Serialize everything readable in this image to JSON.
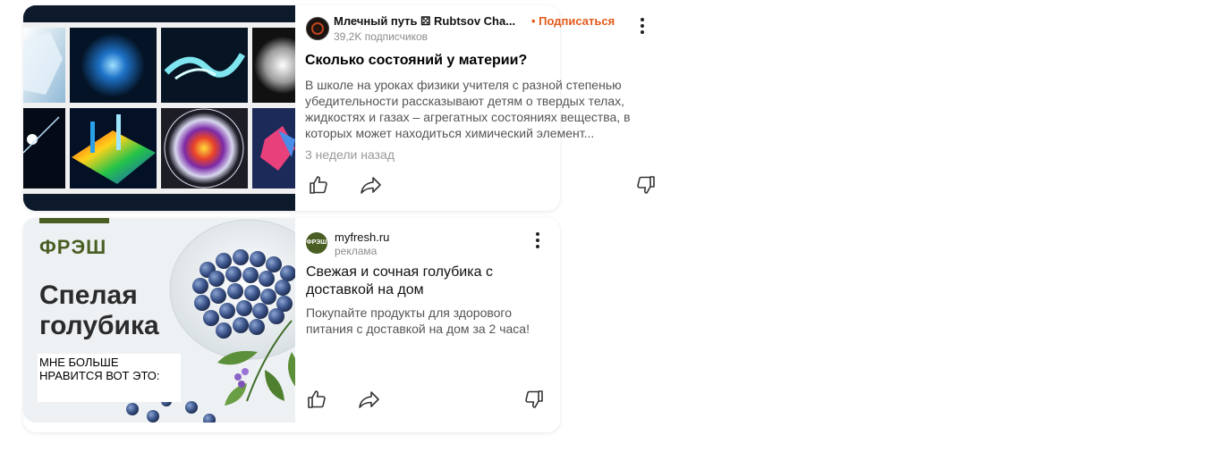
{
  "card1": {
    "source_name": "Млечный путь ⚄ Rubtsov Cha...",
    "subscribe_label": "• Подписаться",
    "subscribers": "39,2K подписчиков",
    "title": "Сколько состояний у материи?",
    "description": "В школе на уроках физики учителя с разной степенью убедительности рассказывают детям о твердых телах, жидкостях и газах – агрегатных состояниях вещества, в которых может находиться химический элемент...",
    "time": "3 недели назад"
  },
  "card2": {
    "source_name": "myfresh.ru",
    "source_sub": "реклама",
    "title": "Свежая и сочная голубика с доставкой на дом",
    "description": "Покупайте продукты для здорового питания с доставкой на дом за 2 часа!",
    "ad_brand": "ФРЭШ",
    "ad_headline_line1": "Спелая",
    "ad_headline_line2": "голубика",
    "ad_overlay_text": "МНЕ БОЛЬШЕ НРАВИТСЯ ВОТ ЭТО:"
  },
  "colors": {
    "subscribe": "#e35a1b",
    "brand_green": "#4a5e23",
    "card_bg": "#ffffff"
  },
  "icons": [
    "like-icon",
    "share-icon",
    "dislike-icon",
    "more-icon"
  ]
}
